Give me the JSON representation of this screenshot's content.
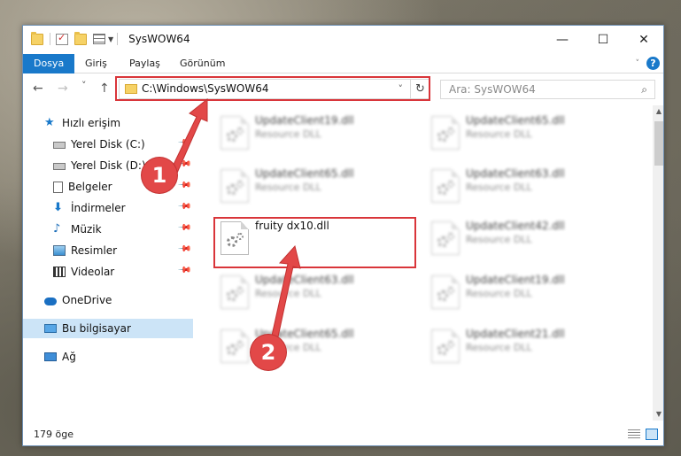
{
  "window": {
    "title": "SysWOW64",
    "controls": {
      "minimize": "—",
      "maximize": "☐",
      "close": "✕"
    }
  },
  "ribbon": {
    "tabs": [
      {
        "label": "Dosya",
        "active": true
      },
      {
        "label": "Giriş"
      },
      {
        "label": "Paylaş"
      },
      {
        "label": "Görünüm"
      }
    ],
    "help": "?"
  },
  "navigation": {
    "back": "←",
    "forward": "→",
    "recent": "˅",
    "up": "↑",
    "address": "C:\\Windows\\SysWOW64",
    "address_dropdown": "˅",
    "refresh": "↻",
    "search_placeholder": "Ara: SysWOW64",
    "search_icon": "⌕"
  },
  "sidebar": {
    "items": [
      {
        "label": "Hızlı erişim",
        "icon": "star-icon",
        "pinned": false
      },
      {
        "label": "Yerel Disk (C:)",
        "icon": "drive-icon",
        "pinned": true
      },
      {
        "label": "Yerel Disk (D:)",
        "icon": "drive-icon",
        "pinned": true
      },
      {
        "label": "Belgeler",
        "icon": "documents-icon",
        "pinned": true
      },
      {
        "label": "İndirmeler",
        "icon": "downloads-icon",
        "pinned": true
      },
      {
        "label": "Müzik",
        "icon": "music-icon",
        "pinned": true
      },
      {
        "label": "Resimler",
        "icon": "pictures-icon",
        "pinned": true
      },
      {
        "label": "Videolar",
        "icon": "videos-icon",
        "pinned": true
      },
      {
        "label": "OneDrive",
        "icon": "cloud-icon",
        "pinned": false
      },
      {
        "label": "Bu bilgisayar",
        "icon": "computer-icon",
        "pinned": false,
        "selected": true
      },
      {
        "label": "Ağ",
        "icon": "network-icon",
        "pinned": false
      }
    ]
  },
  "files": [
    {
      "name": "UpdateClient19.dll",
      "type": "Resource DLL",
      "blurred": true
    },
    {
      "name": "UpdateClient65.dll",
      "type": "Resource DLL",
      "blurred": true
    },
    {
      "name": "UpdateClient65.dll",
      "type": "Resource DLL",
      "blurred": true
    },
    {
      "name": "UpdateClient63.dll",
      "type": "Resource DLL",
      "blurred": true
    },
    {
      "name": "fruity dx10.dll",
      "type": "",
      "blurred": false
    },
    {
      "name": "UpdateClient42.dll",
      "type": "Resource DLL",
      "blurred": true
    },
    {
      "name": "UpdateClient63.dll",
      "type": "Resource DLL",
      "blurred": true
    },
    {
      "name": "UpdateClient19.dll",
      "type": "Resource DLL",
      "blurred": true
    },
    {
      "name": "UpdateClient65.dll",
      "type": "Resource DLL",
      "blurred": true
    },
    {
      "name": "UpdateClient21.dll",
      "type": "Resource DLL",
      "blurred": true
    }
  ],
  "status": {
    "count": "179 öge"
  },
  "annotations": {
    "badge1": "1",
    "badge2": "2",
    "color": "#e24848"
  }
}
